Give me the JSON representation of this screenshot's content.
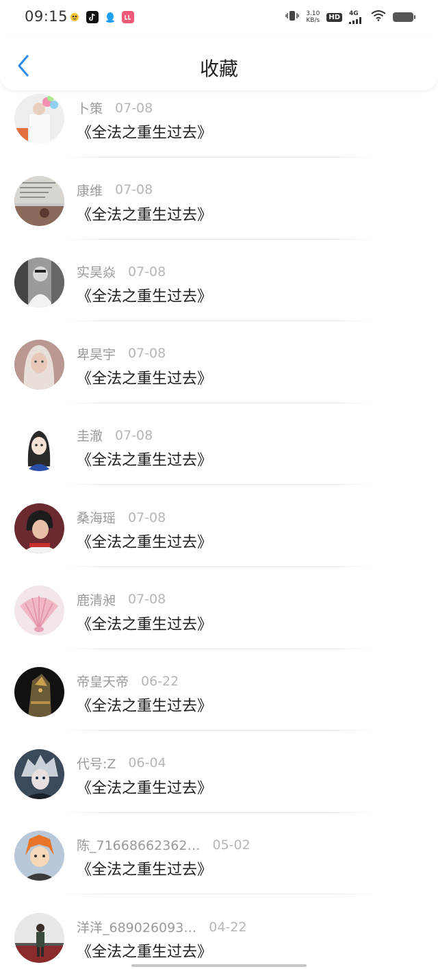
{
  "status_bar": {
    "time": "09:15",
    "net_speed_value": "3.10",
    "net_speed_unit": "KB/s",
    "hd_label": "HD",
    "network_label": "4G"
  },
  "nav": {
    "title": "收藏"
  },
  "items": [
    {
      "user": "卜策",
      "date": "07-08",
      "title": "《全法之重生过去》"
    },
    {
      "user": "康维",
      "date": "07-08",
      "title": "《全法之重生过去》"
    },
    {
      "user": "实昊焱",
      "date": "07-08",
      "title": "《全法之重生过去》"
    },
    {
      "user": "卑昊宇",
      "date": "07-08",
      "title": "《全法之重生过去》"
    },
    {
      "user": "圭澈",
      "date": "07-08",
      "title": "《全法之重生过去》"
    },
    {
      "user": "桑海瑶",
      "date": "07-08",
      "title": "《全法之重生过去》"
    },
    {
      "user": "鹿清昶",
      "date": "07-08",
      "title": "《全法之重生过去》"
    },
    {
      "user": "帝皇天帝",
      "date": "06-22",
      "title": "《全法之重生过去》"
    },
    {
      "user": "代号:Z",
      "date": "06-04",
      "title": "《全法之重生过去》"
    },
    {
      "user": "陈_71668662362…",
      "date": "05-02",
      "title": "《全法之重生过去》"
    },
    {
      "user": "洋洋_689026093…",
      "date": "04-22",
      "title": "《全法之重生过去》"
    }
  ],
  "colors": {
    "accent": "#2f8fe8",
    "title_text": "#222222",
    "meta_text": "#9a9a9a",
    "date_text": "#b6b6b6"
  }
}
